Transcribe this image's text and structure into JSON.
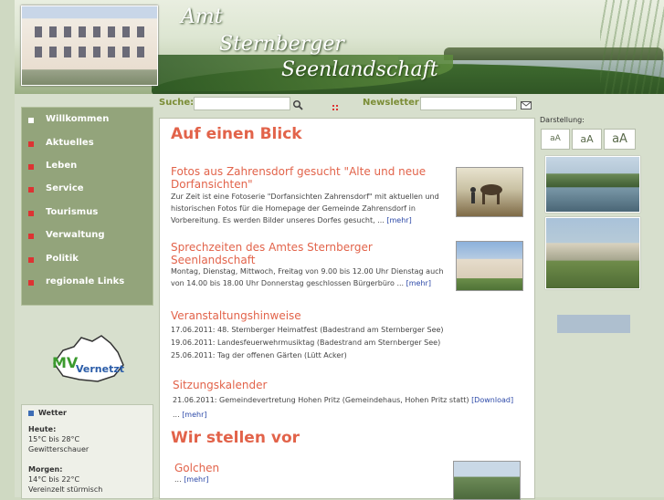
{
  "header": {
    "brand_line1": "Amt",
    "brand_line2": "Sternberger",
    "brand_line3": "Seenlandschaft"
  },
  "toolbar": {
    "search_label": "Suche:",
    "search_value": "",
    "newsletter_label": "Newsletter:",
    "newsletter_value": ""
  },
  "nav": {
    "items": [
      {
        "label": "Willkommen"
      },
      {
        "label": "Aktuelles"
      },
      {
        "label": "Leben"
      },
      {
        "label": "Service"
      },
      {
        "label": "Tourismus"
      },
      {
        "label": "Verwaltung"
      },
      {
        "label": "Politik"
      },
      {
        "label": "regionale Links"
      }
    ]
  },
  "mv_logo": {
    "line1": "MV",
    "line2": "Vernetzt"
  },
  "weather": {
    "title": "Wetter",
    "today_label": "Heute:",
    "today_temp": "15°C bis 28°C",
    "today_desc": "Gewitterschauer",
    "tomorrow_label": "Morgen:",
    "tomorrow_temp": "14°C bis 22°C",
    "tomorrow_desc": "Vereinzelt stürmisch"
  },
  "main": {
    "heading1": "Auf einen Blick",
    "article1": {
      "title": "Fotos aus Zahrensdorf gesucht \"Alte und neue Dorfansichten\"",
      "line1": "Zur Zeit ist eine Fotoserie \"Dorfansichten Zahrensdorf\" mit aktuellen und",
      "line2": "historischen Fotos für die Homepage der Gemeinde Zahrensdorf in",
      "line3": "Vorbereitung. Es werden Bilder unseres Dorfes gesucht, ...",
      "more": "[mehr]"
    },
    "article2": {
      "title": "Sprechzeiten des Amtes Sternberger Seenlandschaft",
      "line1": "Montag, Dienstag, Mittwoch, Freitag von 9.00 bis 12.00 Uhr Dienstag auch",
      "line2": "von 14.00 bis 18.00 Uhr Donnerstag geschlossen   Bürgerbüro ...",
      "more": "[mehr]"
    },
    "events": {
      "title": "Veranstaltungshinweise",
      "items": [
        {
          "date": "17.06.2011:",
          "text": "48. Sternberger Heimatfest (Badestrand am Sternberger See)"
        },
        {
          "date": "19.06.2011:",
          "text": "Landesfeuerwehrmusiktag (Badestrand am Sternberger See)"
        },
        {
          "date": "25.06.2011:",
          "text": "Tag der offenen Gärten (Lütt Acker)"
        }
      ]
    },
    "sessions": {
      "title": "Sitzungskalender",
      "line1": "21.06.2011: Gemeindevertretung Hohen Pritz (Gemeindehaus, Hohen Pritz statt)",
      "download": "[Download]",
      "line2": "...",
      "more": "[mehr]"
    },
    "heading2": "Wir stellen vor",
    "feature": {
      "title": "Golchen",
      "line1": "...",
      "more": "[mehr]"
    }
  },
  "right": {
    "label": "Darstellung:",
    "font_small": "aA",
    "font_medium": "aA",
    "font_large": "aA"
  }
}
